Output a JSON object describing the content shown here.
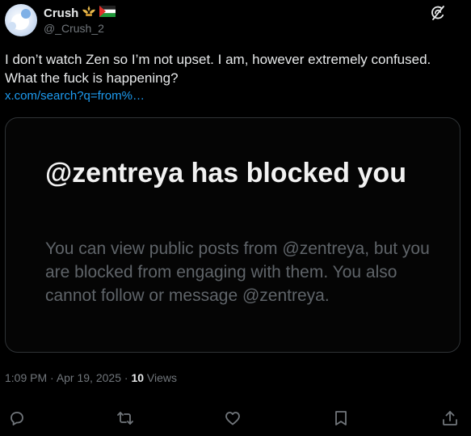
{
  "author": {
    "name": "Crush",
    "emoji_1": "emblem-emoji",
    "emoji_2": "flag-emoji",
    "handle": "@_Crush_2"
  },
  "tweet": {
    "text": "I don’t watch Zen so I’m not upset. I am, however extremely confused. What the fuck is happening?",
    "link": "x.com/search?q=from%…"
  },
  "card": {
    "title": "@zentreya has blocked you",
    "body": "You can view public posts from @zentreya, but you are blocked from engaging with them. You also cannot follow or message @zentreya."
  },
  "meta": {
    "time": "1:09 PM",
    "sep": " · ",
    "date": "Apr 19, 2025",
    "views_count": "10",
    "views_label": " Views"
  },
  "colors": {
    "background": "#000000",
    "text": "#e7e9ea",
    "secondary": "#71767b",
    "link": "#1d9bf0",
    "border": "#2f3336"
  },
  "icons": [
    "grok-icon",
    "reply-icon",
    "repost-icon",
    "like-icon",
    "bookmark-icon",
    "share-icon"
  ]
}
